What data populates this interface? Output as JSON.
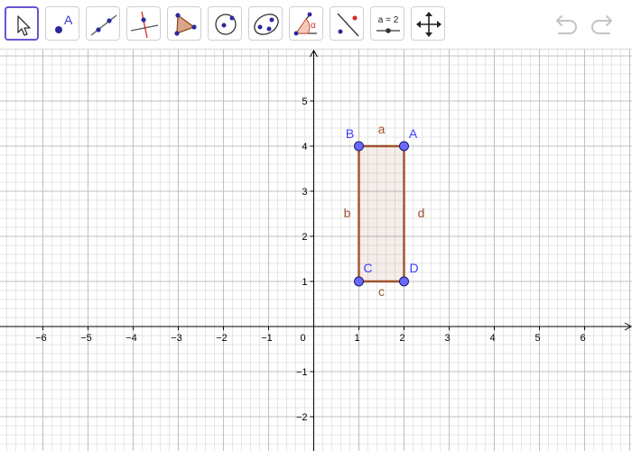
{
  "toolbar": {
    "tools": [
      {
        "id": "move",
        "icon": "move-cursor-icon",
        "selected": true
      },
      {
        "id": "point",
        "icon": "point-icon",
        "label": "A"
      },
      {
        "id": "line",
        "icon": "line-through-two-points-icon"
      },
      {
        "id": "perpendicular",
        "icon": "perpendicular-line-icon"
      },
      {
        "id": "polygon",
        "icon": "polygon-icon"
      },
      {
        "id": "circle",
        "icon": "circle-center-point-icon"
      },
      {
        "id": "conic",
        "icon": "ellipse-icon"
      },
      {
        "id": "angle",
        "icon": "angle-icon",
        "label": "α"
      },
      {
        "id": "reflect",
        "icon": "reflect-about-line-icon"
      },
      {
        "id": "slider",
        "icon": "slider-icon",
        "label": "a = 2"
      },
      {
        "id": "move-view",
        "icon": "move-graphics-view-icon"
      }
    ],
    "undo_icon": "undo-icon",
    "redo_icon": "redo-icon"
  },
  "graphics": {
    "x_ticks": [
      "−6",
      "−5",
      "−4",
      "−3",
      "−2",
      "−1",
      "0",
      "1",
      "2",
      "3",
      "4",
      "5",
      "6"
    ],
    "x_tick_values": [
      -6,
      -5,
      -4,
      -3,
      -2,
      -1,
      0,
      1,
      2,
      3,
      4,
      5,
      6
    ],
    "y_ticks": [
      "5",
      "4",
      "3",
      "2",
      "1",
      "−1",
      "−2"
    ],
    "y_tick_values": [
      5,
      4,
      3,
      2,
      1,
      -1,
      -2
    ],
    "x_range": [
      -6.95,
      7.05
    ],
    "y_range": [
      -2.76,
      6.14
    ],
    "minor_grid_step": 0.2,
    "colors": {
      "grid_major": "#c0c0c0",
      "grid_minor": "#e6e6e6",
      "axis": "#000000",
      "polygon_stroke": "#a0522d",
      "polygon_fill": "#a0522d",
      "point_fill": "#6a6aff",
      "point_label": "#3c3cff",
      "segment_label": "#a0522d"
    },
    "points": [
      {
        "name": "A",
        "x": 2,
        "y": 4
      },
      {
        "name": "B",
        "x": 1,
        "y": 4
      },
      {
        "name": "C",
        "x": 1,
        "y": 1
      },
      {
        "name": "D",
        "x": 2,
        "y": 1
      }
    ],
    "segments": [
      {
        "name": "a",
        "from": "A",
        "to": "B"
      },
      {
        "name": "b",
        "from": "B",
        "to": "C"
      },
      {
        "name": "c",
        "from": "C",
        "to": "D"
      },
      {
        "name": "d",
        "from": "D",
        "to": "A"
      }
    ]
  }
}
